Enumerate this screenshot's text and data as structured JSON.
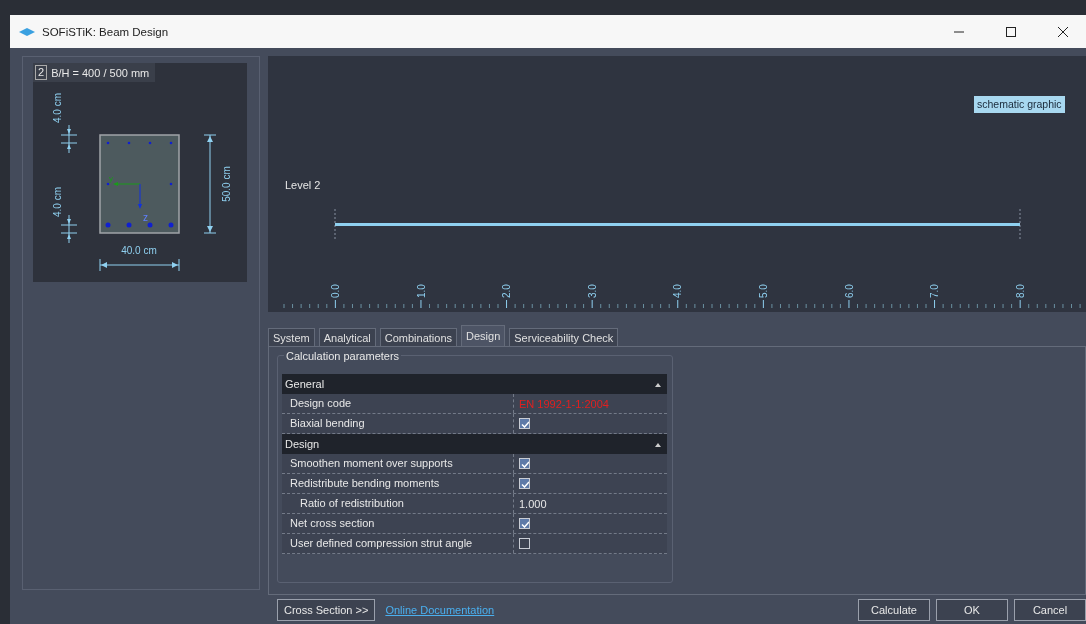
{
  "window": {
    "title": "SOFiSTiK: Beam Design"
  },
  "section": {
    "number": "2",
    "label": "B/H = 400 / 500 mm",
    "top_cover": "4.0 cm",
    "bottom_cover": "4.0 cm",
    "height": "50.0 cm",
    "width": "40.0 cm",
    "axis_y": "y",
    "axis_z": "z"
  },
  "graphic": {
    "badge": "schematic graphic",
    "level": "Level 2",
    "ruler": [
      "0.0",
      "1.0",
      "2.0",
      "3.0",
      "4.0",
      "5.0",
      "6.0",
      "7.0",
      "8.0"
    ]
  },
  "tabs": [
    {
      "label": "System",
      "selected": false
    },
    {
      "label": "Analytical",
      "selected": false
    },
    {
      "label": "Combinations",
      "selected": false
    },
    {
      "label": "Design",
      "selected": true
    },
    {
      "label": "Serviceability Check",
      "selected": false
    }
  ],
  "group": {
    "title": "Calculation parameters",
    "categories": [
      {
        "name": "General",
        "expanded": true,
        "rows": [
          {
            "kind": "text",
            "label": "Design code",
            "value": "EN 1992-1-1:2004",
            "error": true
          },
          {
            "kind": "checkbox",
            "label": "Biaxial bending",
            "checked": true
          }
        ]
      },
      {
        "name": "Design",
        "expanded": true,
        "rows": [
          {
            "kind": "checkbox",
            "label": "Smoothen moment over supports",
            "checked": true
          },
          {
            "kind": "checkbox",
            "label": "Redistribute bending moments",
            "checked": true,
            "children": [
              {
                "kind": "text",
                "label": "Ratio of redistribution",
                "value": "1.000",
                "error": false
              }
            ]
          },
          {
            "kind": "checkbox",
            "label": "Net cross section",
            "checked": true
          },
          {
            "kind": "checkbox",
            "label": "User defined compression strut angle",
            "checked": false
          }
        ]
      }
    ]
  },
  "footer": {
    "cross_section": "Cross Section >>",
    "link": "Online Documentation",
    "buttons": [
      "Calculate",
      "OK",
      "Cancel"
    ]
  }
}
